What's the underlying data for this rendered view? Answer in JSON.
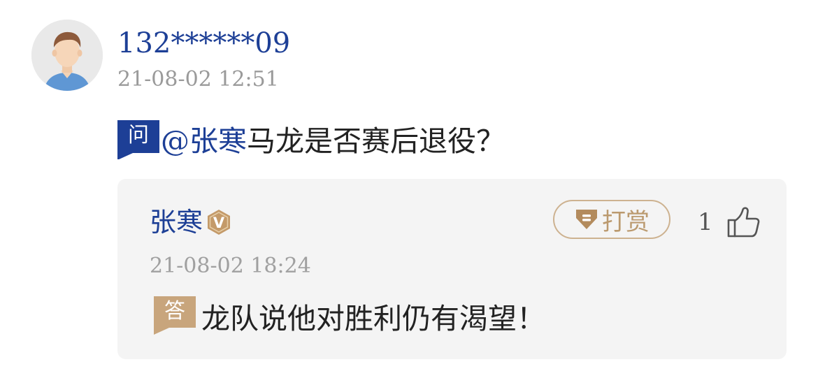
{
  "comment": {
    "user": {
      "name": "132******09",
      "avatar_icon": "default-user-avatar"
    },
    "time": "21-08-02 12:51",
    "question": {
      "badge": "问",
      "mention": "@张寒",
      "text": "马龙是否赛后退役？"
    }
  },
  "answer": {
    "name": "张寒",
    "verified_badge": "V",
    "reward_label": "打赏",
    "like_count": "1",
    "time": "21-08-02 18:24",
    "badge": "答",
    "text": "龙队说他对胜利仍有渴望！"
  },
  "colors": {
    "link_blue": "#1d3f96",
    "question_badge": "#1d3f96",
    "answer_badge": "#c8a57c",
    "verified_badge": "#c49a69",
    "reward_border": "#cdb290",
    "card_background": "#f4f4f4",
    "timestamp": "#9a9a9a"
  }
}
